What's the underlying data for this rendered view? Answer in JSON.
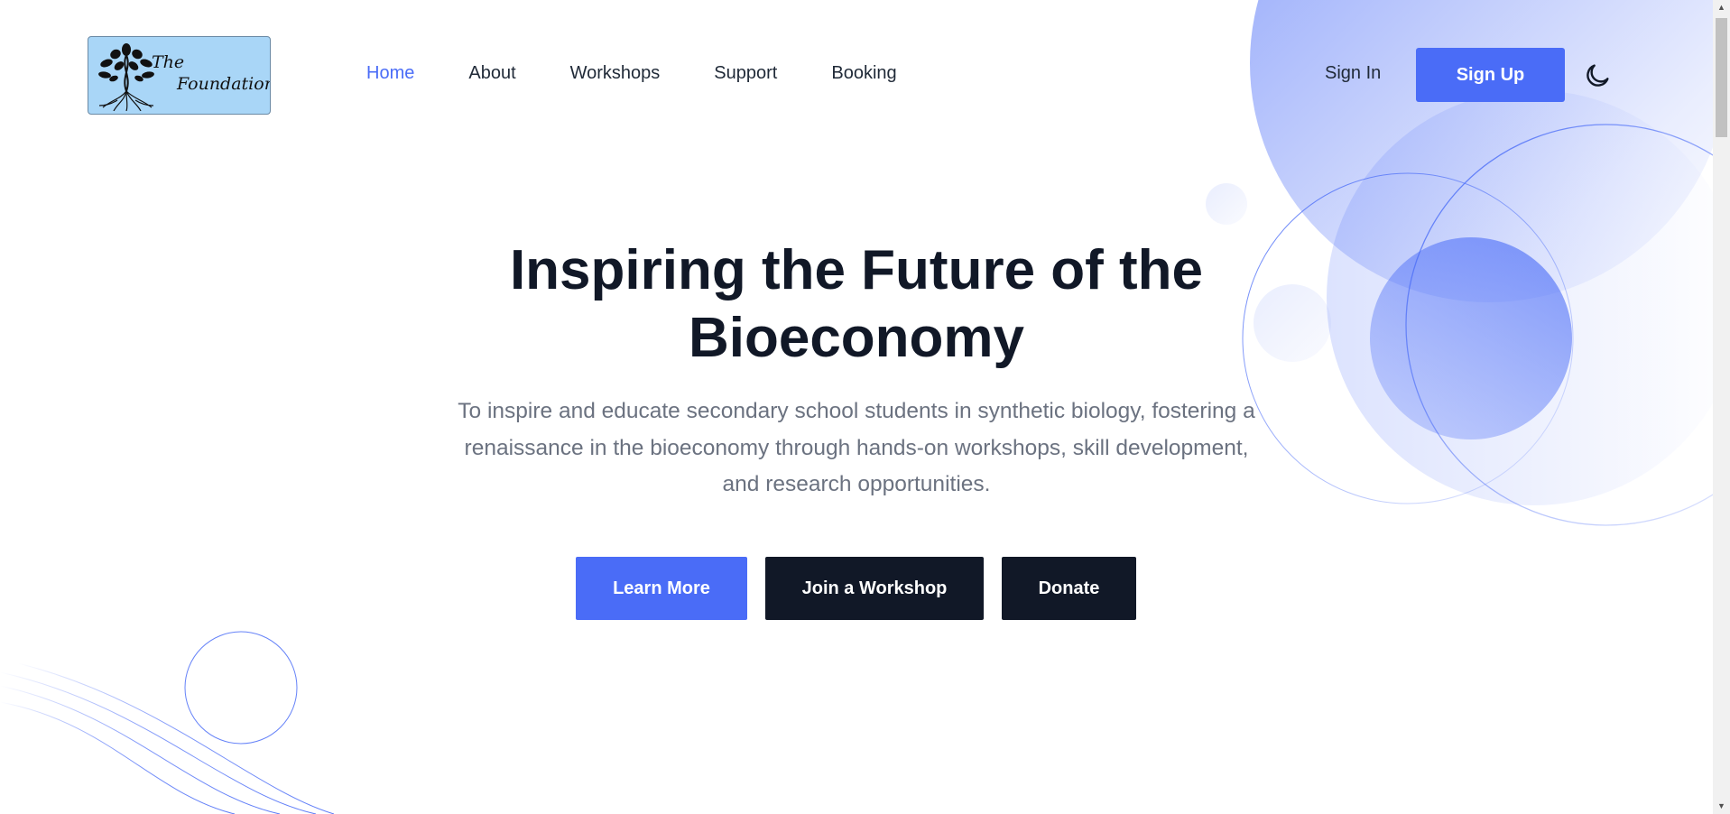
{
  "brand": {
    "logo_line1": "The",
    "logo_line2": "Foundation",
    "logo_bg": "#a9d6f7"
  },
  "nav": {
    "items": [
      {
        "label": "Home",
        "active": true
      },
      {
        "label": "About",
        "active": false
      },
      {
        "label": "Workshops",
        "active": false
      },
      {
        "label": "Support",
        "active": false
      },
      {
        "label": "Booking",
        "active": false
      }
    ]
  },
  "auth": {
    "sign_in": "Sign In",
    "sign_up": "Sign Up"
  },
  "theme_toggle": {
    "icon": "moon-icon"
  },
  "hero": {
    "title_line1": "Inspiring the Future of the",
    "title_line2": "Bioeconomy",
    "description_line1": "To inspire and educate secondary school students in synthetic biology, fostering a",
    "description_line2": "renaissance in the bioeconomy through hands-on workshops, skill development,",
    "description_line3": "and research opportunities.",
    "buttons": {
      "learn_more": "Learn More",
      "join_workshop": "Join a Workshop",
      "donate": "Donate"
    }
  },
  "colors": {
    "accent": "#4a6cf7",
    "dark": "#111827",
    "text_muted": "#6b7280",
    "nav_text": "#1f2937"
  }
}
